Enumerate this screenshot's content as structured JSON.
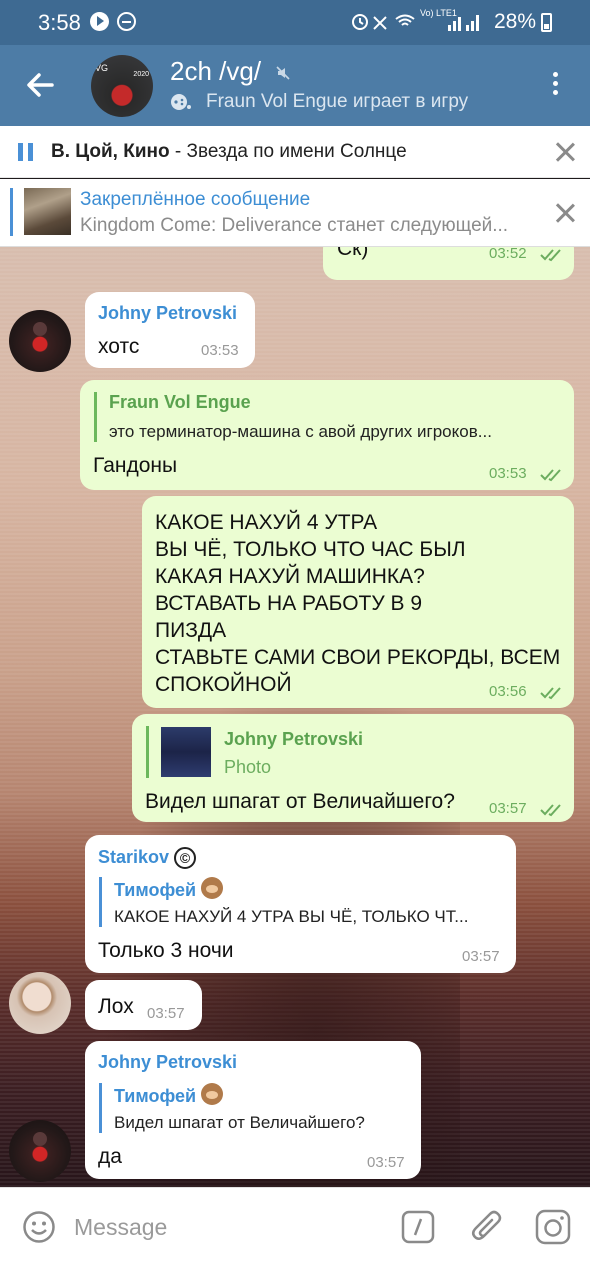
{
  "status_bar": {
    "time": "3:58",
    "signal_text": "Vo) LTE1",
    "battery": "28%"
  },
  "header": {
    "title": "2ch /vg/",
    "subtitle": "Fraun Vol Engue играет в игру",
    "avatar_text": "VG",
    "avatar_year": "2020"
  },
  "player": {
    "artist": "В. Цой, Кино",
    "separator": " - ",
    "song": "Звезда по имени Солнце"
  },
  "pinned": {
    "title": "Закреплённое сообщение",
    "text": "Kingdom Come: Deliverance станет следующей..."
  },
  "messages": [
    {
      "text": "Ск)",
      "time": "03:52"
    },
    {
      "sender": "Johny Petrovski",
      "text": "хотс",
      "time": "03:53"
    },
    {
      "reply_name": "Fraun Vol Engue",
      "reply_text": "это терминатор-машина с авой других игроков...",
      "text": "Гандоны",
      "time": "03:53"
    },
    {
      "lines": [
        "КАКОЕ НАХУЙ 4 УТРА",
        "ВЫ ЧЁ, ТОЛЬКО ЧТО ЧАС БЫЛ",
        "КАКАЯ НАХУЙ МАШИНКА?",
        "ВСТАВАТЬ НА РАБОТУ В 9",
        "ПИЗДА",
        "СТАВЬТЕ САМИ СВОИ РЕКОРДЫ, ВСЕМ",
        "СПОКОЙНОЙ"
      ],
      "time": "03:56"
    },
    {
      "reply_name": "Johny Petrovski",
      "reply_text": "Photo",
      "text": "Видел шпагат от Величайшего?",
      "time": "03:57"
    },
    {
      "sender": "Starikov",
      "sender_badge": "©",
      "reply_name": "Тимофей",
      "reply_text": "КАКОЕ НАХУЙ 4 УТРА ВЫ ЧЁ, ТОЛЬКО ЧТ...",
      "text": "Только 3 ночи",
      "time": "03:57"
    },
    {
      "text": "Лох",
      "time": "03:57"
    },
    {
      "sender": "Johny Petrovski",
      "reply_name": "Тимофей",
      "reply_text": "Видел шпагат от Величайшего?",
      "text": "да",
      "time": "03:57"
    }
  ],
  "input": {
    "placeholder": "Message"
  },
  "colors": {
    "header": "#4d7ca6",
    "statusbar": "#3e6a92",
    "accent": "#3d8ed4",
    "outgoing_bubble": "#ebfdd2",
    "incoming_bubble": "#ffffff"
  }
}
